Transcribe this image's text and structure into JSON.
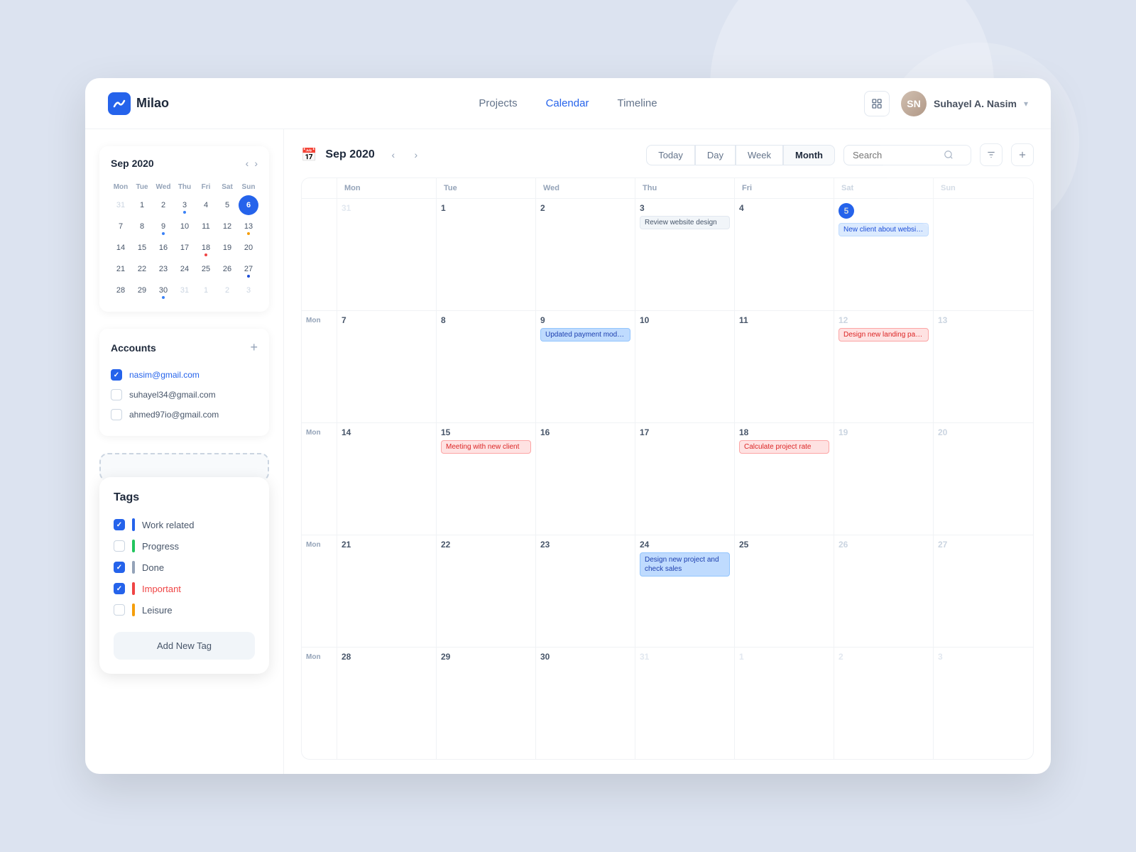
{
  "app": {
    "logo_text": "Milao",
    "nav": {
      "links": [
        "Projects",
        "Calendar",
        "Timeline"
      ],
      "active": "Calendar"
    },
    "user": {
      "name": "Suhayel A. Nasim",
      "initials": "SN"
    }
  },
  "mini_calendar": {
    "title": "Sep 2020",
    "day_headers": [
      "Mon",
      "Tue",
      "Wed",
      "Thu",
      "Fri",
      "Sat",
      "Sun"
    ],
    "weeks": [
      [
        {
          "d": "31",
          "om": true
        },
        {
          "d": "1"
        },
        {
          "d": "2"
        },
        {
          "d": "3",
          "dot": "blue"
        },
        {
          "d": "4"
        },
        {
          "d": "5"
        },
        {
          "d": "6",
          "today": true
        }
      ],
      [
        {
          "d": "7"
        },
        {
          "d": "8"
        },
        {
          "d": "9",
          "dot": "blue"
        },
        {
          "d": "10"
        },
        {
          "d": "11"
        },
        {
          "d": "12"
        },
        {
          "d": "13",
          "dot": "yellow"
        }
      ],
      [
        {
          "d": "14"
        },
        {
          "d": "15"
        },
        {
          "d": "16"
        },
        {
          "d": "17"
        },
        {
          "d": "18",
          "dot": "red"
        },
        {
          "d": "19"
        },
        {
          "d": "20"
        }
      ],
      [
        {
          "d": "21"
        },
        {
          "d": "22"
        },
        {
          "d": "23"
        },
        {
          "d": "24"
        },
        {
          "d": "25"
        },
        {
          "d": "26"
        },
        {
          "d": "27",
          "dot": "blue2"
        }
      ],
      [
        {
          "d": "28"
        },
        {
          "d": "29"
        },
        {
          "d": "30",
          "dot": "blue"
        },
        {
          "d": "31",
          "om": true
        },
        {
          "d": "1",
          "om": true
        },
        {
          "d": "2",
          "om": true
        },
        {
          "d": "3",
          "om": true
        }
      ]
    ]
  },
  "accounts": {
    "title": "Accounts",
    "items": [
      {
        "email": "nasim@gmail.com",
        "checked": true
      },
      {
        "email": "suhayel34@gmail.com",
        "checked": false
      },
      {
        "email": "ahmed97io@gmail.com",
        "checked": false
      }
    ]
  },
  "tags": {
    "title": "Tags",
    "items": [
      {
        "label": "Work related",
        "color": "#2563eb",
        "checked": true
      },
      {
        "label": "Progress",
        "color": "#22c55e",
        "checked": false
      },
      {
        "label": "Done",
        "color": "#94a3b8",
        "checked": true
      },
      {
        "label": "Important",
        "color": "#ef4444",
        "checked": true,
        "important": true
      },
      {
        "label": "Leisure",
        "color": "#f59e0b",
        "checked": false
      }
    ],
    "add_label": "Add New Tag"
  },
  "calendar": {
    "title": "Sep 2020",
    "view_buttons": [
      "Today",
      "Day",
      "Week",
      "Month"
    ],
    "active_view": "Month",
    "search_placeholder": "Search",
    "day_headers": [
      "",
      "Mon",
      "Tue",
      "Wed",
      "Thu",
      "Fri",
      "Sat",
      "Sun"
    ],
    "weeks": [
      {
        "label": "",
        "days": [
          {
            "date": "31",
            "om": true,
            "events": []
          },
          {
            "date": "1",
            "events": []
          },
          {
            "date": "2",
            "events": []
          },
          {
            "date": "3",
            "events": [
              {
                "text": "Review website design",
                "type": "gray"
              }
            ]
          },
          {
            "date": "4",
            "events": []
          },
          {
            "date": "5",
            "today": true,
            "events": [
              {
                "text": "New client about website design at our office",
                "type": "blue"
              }
            ]
          },
          {
            "date": "",
            "sun": true,
            "events": []
          }
        ]
      },
      {
        "label": "",
        "days": [
          {
            "date": "7",
            "events": []
          },
          {
            "date": "8",
            "events": []
          },
          {
            "date": "9",
            "events": [
              {
                "text": "Updated payment modules based on project",
                "type": "blue-light"
              }
            ]
          },
          {
            "date": "10",
            "events": []
          },
          {
            "date": "11",
            "events": []
          },
          {
            "date": "12",
            "events": [
              {
                "text": "Design new landing pages",
                "type": "red"
              }
            ]
          },
          {
            "date": "13",
            "sun": true,
            "events": []
          }
        ]
      },
      {
        "label": "",
        "days": [
          {
            "date": "14",
            "events": []
          },
          {
            "date": "15",
            "events": [
              {
                "text": "Meeting with new client",
                "type": "red"
              }
            ]
          },
          {
            "date": "16",
            "events": []
          },
          {
            "date": "17",
            "events": []
          },
          {
            "date": "18",
            "events": [
              {
                "text": "Calculate project rate",
                "type": "red"
              }
            ]
          },
          {
            "date": "19",
            "events": []
          },
          {
            "date": "20",
            "sun": true,
            "events": []
          }
        ]
      },
      {
        "label": "",
        "days": [
          {
            "date": "21",
            "events": []
          },
          {
            "date": "22",
            "events": []
          },
          {
            "date": "23",
            "events": []
          },
          {
            "date": "24",
            "events": [
              {
                "text": "Design new project and check sales",
                "type": "blue-light"
              }
            ]
          },
          {
            "date": "25",
            "events": []
          },
          {
            "date": "26",
            "events": []
          },
          {
            "date": "27",
            "sun": true,
            "events": []
          }
        ]
      },
      {
        "label": "",
        "days": [
          {
            "date": "28",
            "events": []
          },
          {
            "date": "29",
            "events": []
          },
          {
            "date": "30",
            "events": []
          },
          {
            "date": "31",
            "events": []
          },
          {
            "date": "1",
            "om": true,
            "events": []
          },
          {
            "date": "2",
            "om": true,
            "events": []
          },
          {
            "date": "3",
            "om": true,
            "events": []
          }
        ]
      }
    ]
  }
}
